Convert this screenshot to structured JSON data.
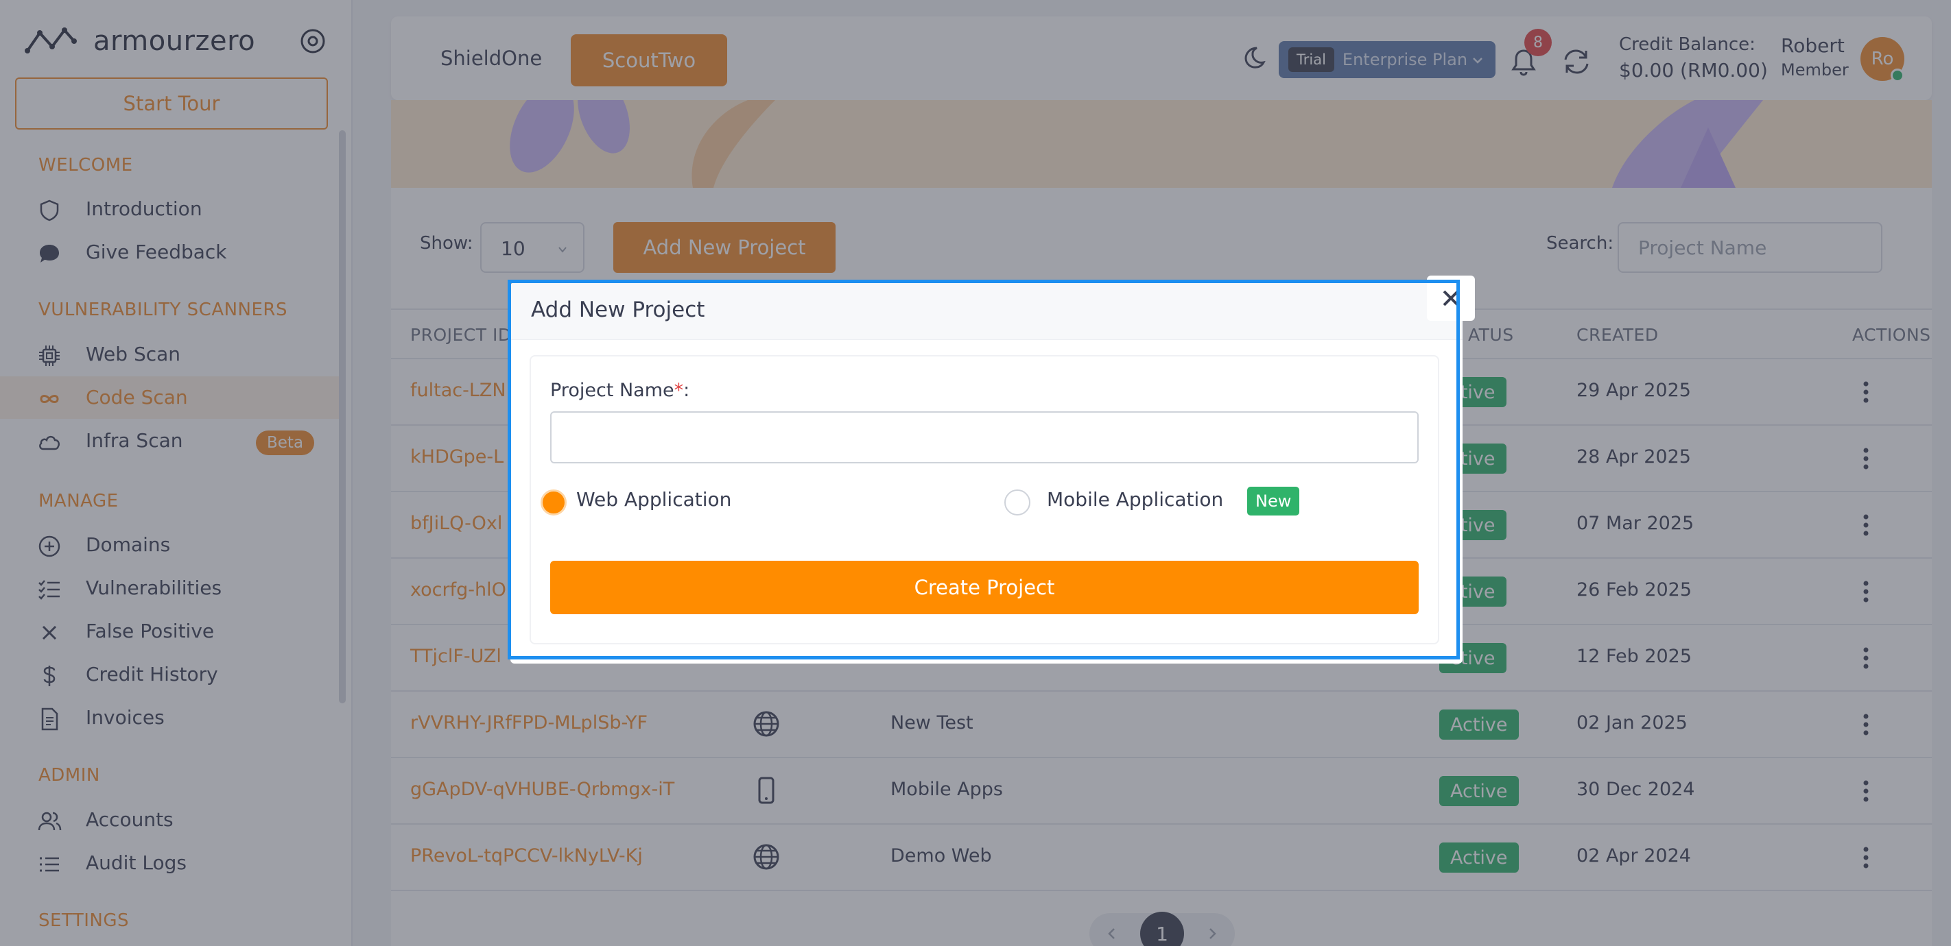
{
  "sidebar": {
    "brand": "armourzero",
    "start_tour": "Start Tour",
    "sections": {
      "welcome": "WELCOME",
      "scanners": "VULNERABILITY SCANNERS",
      "manage": "MANAGE",
      "admin": "ADMIN",
      "settings": "SETTINGS"
    },
    "items": {
      "introduction": "Introduction",
      "give_feedback": "Give Feedback",
      "web_scan": "Web Scan",
      "code_scan": "Code Scan",
      "infra_scan": "Infra Scan",
      "infra_badge": "Beta",
      "domains": "Domains",
      "vulnerabilities": "Vulnerabilities",
      "false_positive": "False Positive",
      "credit_history": "Credit History",
      "invoices": "Invoices",
      "accounts": "Accounts",
      "audit_logs": "Audit Logs"
    }
  },
  "header": {
    "tab_shield": "ShieldOne",
    "tab_scout": "ScoutTwo",
    "trial_tag": "Trial",
    "plan_name": "Enterprise Plan",
    "notification_count": "8",
    "credit_label": "Credit Balance:",
    "credit_value": "$0.00 (RM0.00)",
    "user_name": "Robert",
    "user_role": "Member",
    "avatar_initials": "Ro"
  },
  "toolbar": {
    "show_label": "Show:",
    "show_value": "10",
    "add_button": "Add New Project",
    "search_label": "Search:",
    "search_placeholder": "Project Name"
  },
  "table": {
    "headers": {
      "project_id": "PROJECT ID",
      "status": "ATUS",
      "created": "CREATED",
      "actions": "ACTIONS"
    },
    "rows": [
      {
        "id": "fultac-LZN",
        "type": "",
        "name": "",
        "status": "ctive",
        "created": "29 Apr 2025"
      },
      {
        "id": "kHDGpe-L",
        "type": "",
        "name": "",
        "status": "ctive",
        "created": "28 Apr 2025"
      },
      {
        "id": "bfJiLQ-Oxl",
        "type": "",
        "name": "",
        "status": "ctive",
        "created": "07 Mar 2025"
      },
      {
        "id": "xocrfg-hlO",
        "type": "",
        "name": "",
        "status": "ctive",
        "created": "26 Feb 2025"
      },
      {
        "id": "TTjclF-UZl",
        "type": "",
        "name": "",
        "status": "ctive",
        "created": "12 Feb 2025"
      },
      {
        "id": "rVVRHY-JRfFPD-MLplSb-YF",
        "type": "globe-icon",
        "name": "New Test",
        "status": "Active",
        "created": "02 Jan 2025"
      },
      {
        "id": "gGApDV-qVHUBE-Qrbmgx-iT",
        "type": "mobile-icon",
        "name": "Mobile Apps",
        "status": "Active",
        "created": "30 Dec 2024"
      },
      {
        "id": "PRevoL-tqPCCV-lkNyLV-Kj",
        "type": "globe-icon",
        "name": "Demo Web",
        "status": "Active",
        "created": "02 Apr 2024"
      }
    ]
  },
  "pagination": {
    "current": "1"
  },
  "modal": {
    "title": "Add New Project",
    "field_label": "Project Name",
    "required_mark": "*",
    "field_suffix": ":",
    "name_value": "",
    "option_web": "Web Application",
    "option_mobile": "Mobile Application",
    "mobile_badge": "New",
    "selected_option": "Web Application",
    "create_button": "Create Project"
  },
  "colors": {
    "accent": "#ee8b2d",
    "create_button": "#ff8c00",
    "status_active": "#2fb36a",
    "focus_ring": "#1d8ff0",
    "plan_pill": "#5d78a8",
    "alert": "#e04545"
  }
}
